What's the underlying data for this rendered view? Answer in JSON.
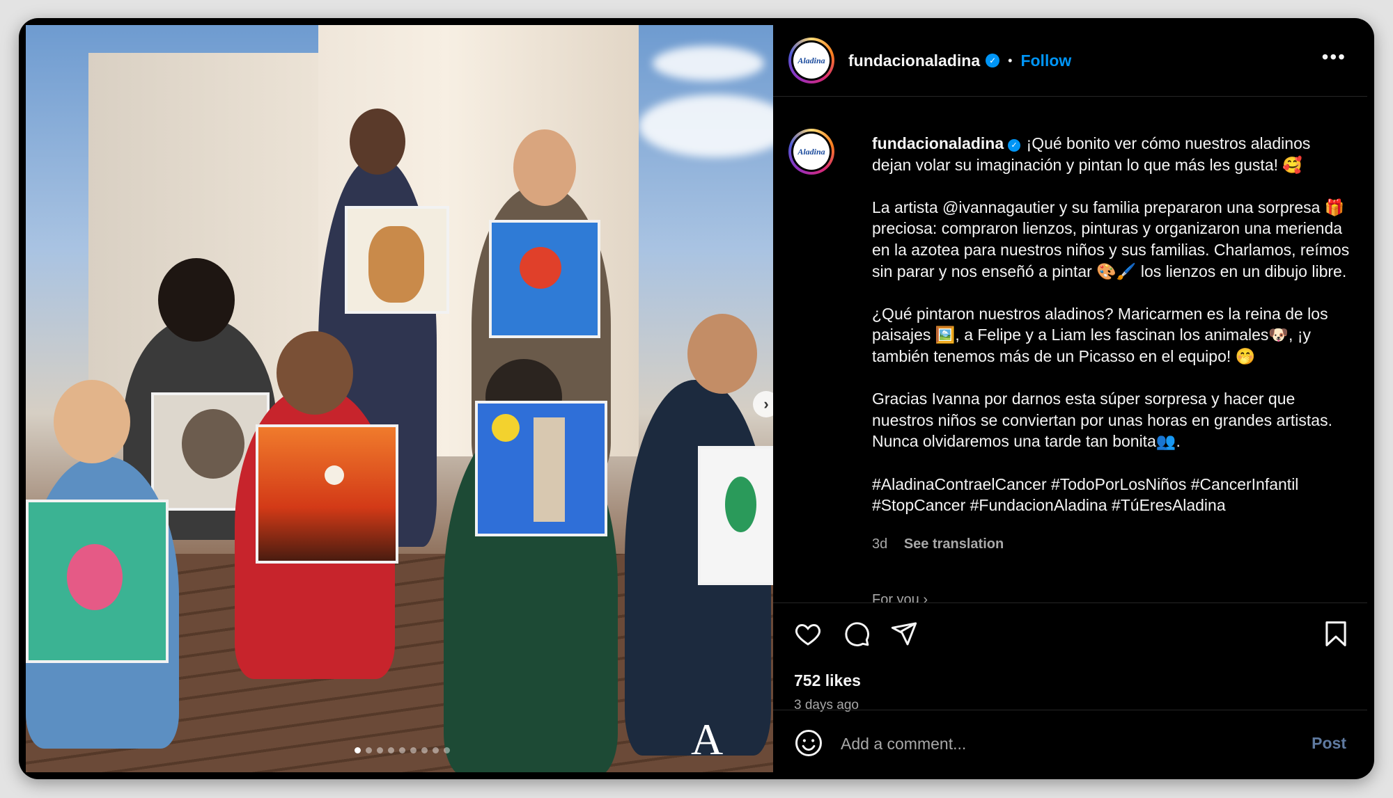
{
  "post": {
    "username": "fundacionaladina",
    "follow_label": "Follow",
    "separator": "•",
    "more_label": "•••",
    "avatar_text": "Aladina"
  },
  "caption": {
    "username": "fundacionaladina",
    "text": " ¡Qué bonito ver cómo nuestros aladinos dejan volar su imaginación y pintan lo que más les gusta! 🥰\n\nLa artista @ivannagautier y su familia prepararon una sorpresa 🎁 preciosa: compraron lienzos, pinturas y organizaron una merienda en la azotea para nuestros niños y sus familias. Charlamos, reímos sin parar y nos enseñó a pintar 🎨🖌️ los lienzos en un dibujo libre.\n\n¿Qué pintaron nuestros aladinos? Maricarmen es la reina de los paisajes 🖼️, a Felipe y a Liam les fascinan los animales🐶, ¡y también tenemos más de un Picasso en el equipo! 🤭\n\nGracias Ivanna por darnos esta súper sorpresa y hacer que nuestros niños se conviertan por unas horas en grandes artistas. Nunca olvidaremos una tarde tan bonita👥.\n\n#AladinaContraelCancer #TodoPorLosNiños #CancerInfantil #StopCancer #FundacionAladina #TúEresAladina",
    "age": "3d",
    "translate_label": "See translation",
    "for_you_label": "For you ›"
  },
  "engagement": {
    "likes": "752 likes",
    "posted": "3 days ago"
  },
  "comment": {
    "placeholder": "Add a comment...",
    "post_label": "Post"
  },
  "carousel": {
    "total": 9,
    "current": 1,
    "next_glyph": "›"
  },
  "photo": {
    "watermark": "A"
  },
  "icons": [
    "like-icon",
    "comment-icon",
    "share-icon",
    "save-icon",
    "emoji-icon",
    "verified-icon",
    "more-icon",
    "next-icon"
  ],
  "colors": {
    "accent": "#0095f6",
    "background": "#000000",
    "text": "#f5f5f5",
    "muted": "#a8a8a8"
  }
}
